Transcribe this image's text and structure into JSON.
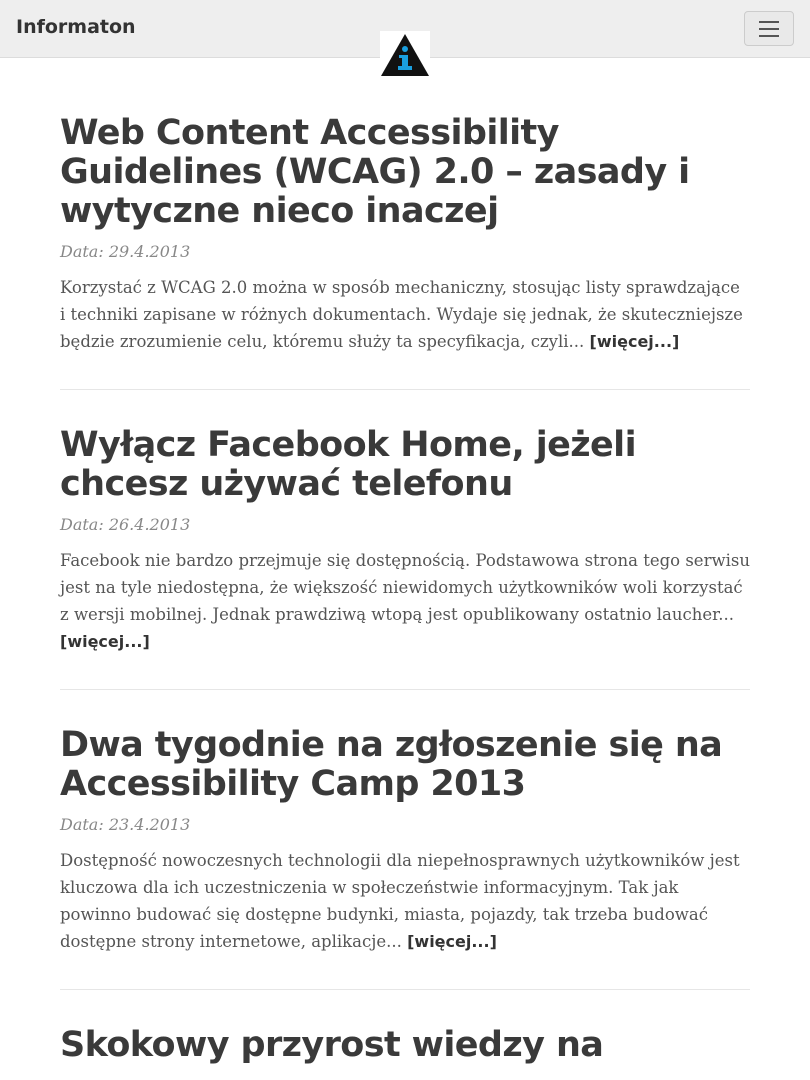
{
  "navbar": {
    "brand": "Informaton",
    "logo_icon": "info-triangle-icon",
    "menu_icon": "hamburger-menu-icon"
  },
  "posts": [
    {
      "title": "Web Content Accessibility Guidelines (WCAG) 2.0 – zasady i wytyczne nieco inaczej",
      "date": "Data: 29.4.2013",
      "excerpt": "Korzystać z WCAG 2.0 można w sposób mechaniczny, stosując listy sprawdzające i techniki zapisane w różnych dokumentach. Wydaje się jednak, że skuteczniejsze będzie zrozumienie celu, któremu służy ta specyfikacja, czyli...",
      "more": "[więcej...]"
    },
    {
      "title": "Wyłącz Facebook Home, jeżeli chcesz używać telefonu",
      "date": "Data: 26.4.2013",
      "excerpt": "Facebook nie bardzo przejmuje się dostępnością. Podstawowa strona tego serwisu jest na tyle niedostępna, że większość niewidomych użytkowników woli korzystać z wersji mobilnej. Jednak prawdziwą wtopą jest opublikowany ostatnio laucher...",
      "more": "[więcej...]"
    },
    {
      "title": "Dwa tygodnie na zgłoszenie się na Accessibility Camp 2013",
      "date": "Data: 23.4.2013",
      "excerpt": "Dostępność nowoczesnych technologii dla niepełnosprawnych użytkowników jest kluczowa dla ich uczestniczenia w społeczeństwie informacyjnym. Tak jak powinno budować się dostępne budynki, miasta, pojazdy, tak trzeba budować dostępne strony internetowe, aplikacje...",
      "more": "[więcej...]"
    },
    {
      "title": "Skokowy przyrost wiedzy na"
    }
  ],
  "colors": {
    "navbar_bg": "#eeeeee",
    "title": "#3a3a3a",
    "text": "#555555",
    "date": "#888888",
    "logo_accent": "#1a9fe0"
  }
}
